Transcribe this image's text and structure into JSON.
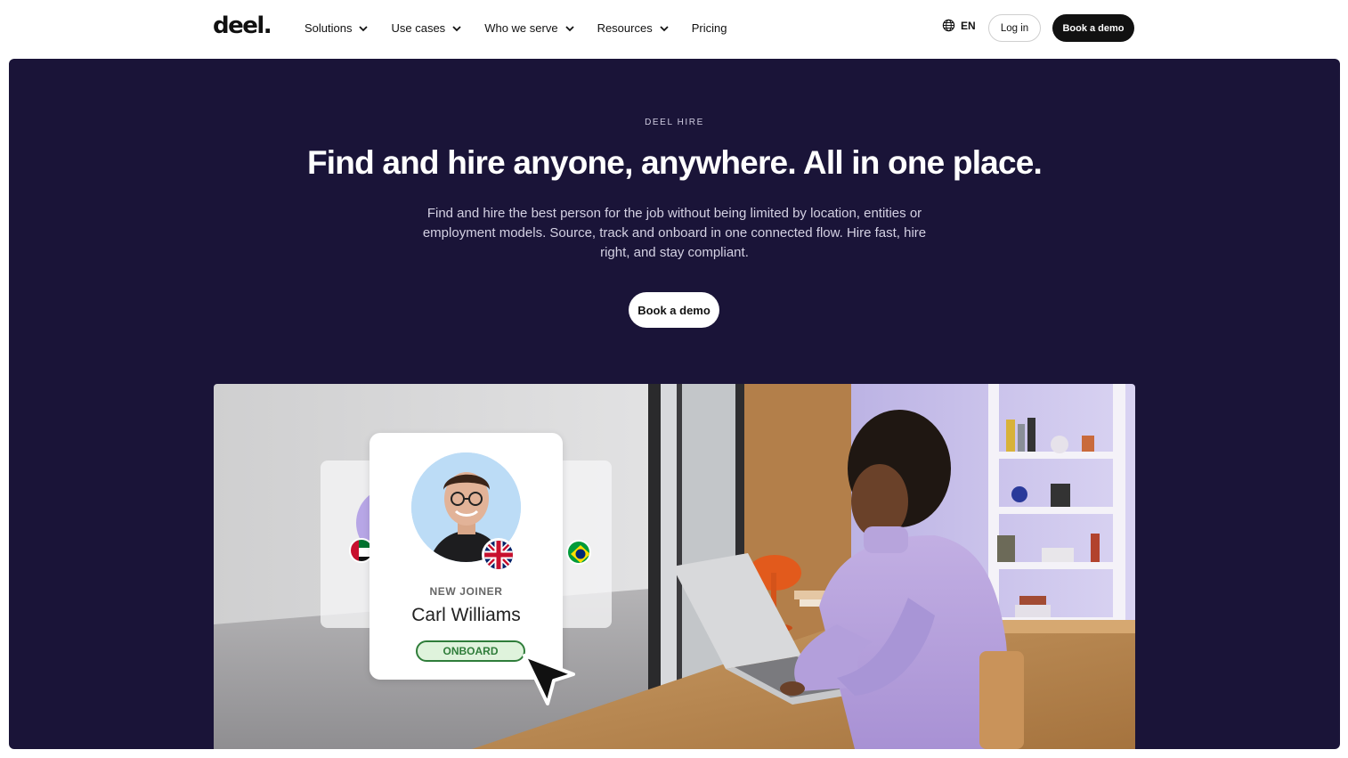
{
  "header": {
    "logo": "deel.",
    "nav": [
      {
        "label": "Solutions",
        "has_dropdown": true
      },
      {
        "label": "Use cases",
        "has_dropdown": true
      },
      {
        "label": "Who we serve",
        "has_dropdown": true
      },
      {
        "label": "Resources",
        "has_dropdown": true
      },
      {
        "label": "Pricing",
        "has_dropdown": false
      }
    ],
    "language": {
      "icon": "globe-icon",
      "label": "EN"
    },
    "login_label": "Log in",
    "demo_label": "Book a demo"
  },
  "hero": {
    "eyebrow": "DEEL HIRE",
    "headline": "Find and hire anyone, anywhere. All in one place.",
    "subcopy": "Find and hire the best person for the job without being limited by location, entities or employment models. Source, track and onboard in one connected flow. Hire fast, hire right, and stay compliant.",
    "cta_label": "Book a demo",
    "background_color": "#1a1438"
  },
  "profile_card": {
    "label": "NEW JOINER",
    "name": "Carl Williams",
    "action_label": "ONBOARD",
    "flags": [
      "uk-flag-icon",
      "uae-flag-icon",
      "brazil-flag-icon"
    ],
    "action_color": "#2f7d3a"
  }
}
